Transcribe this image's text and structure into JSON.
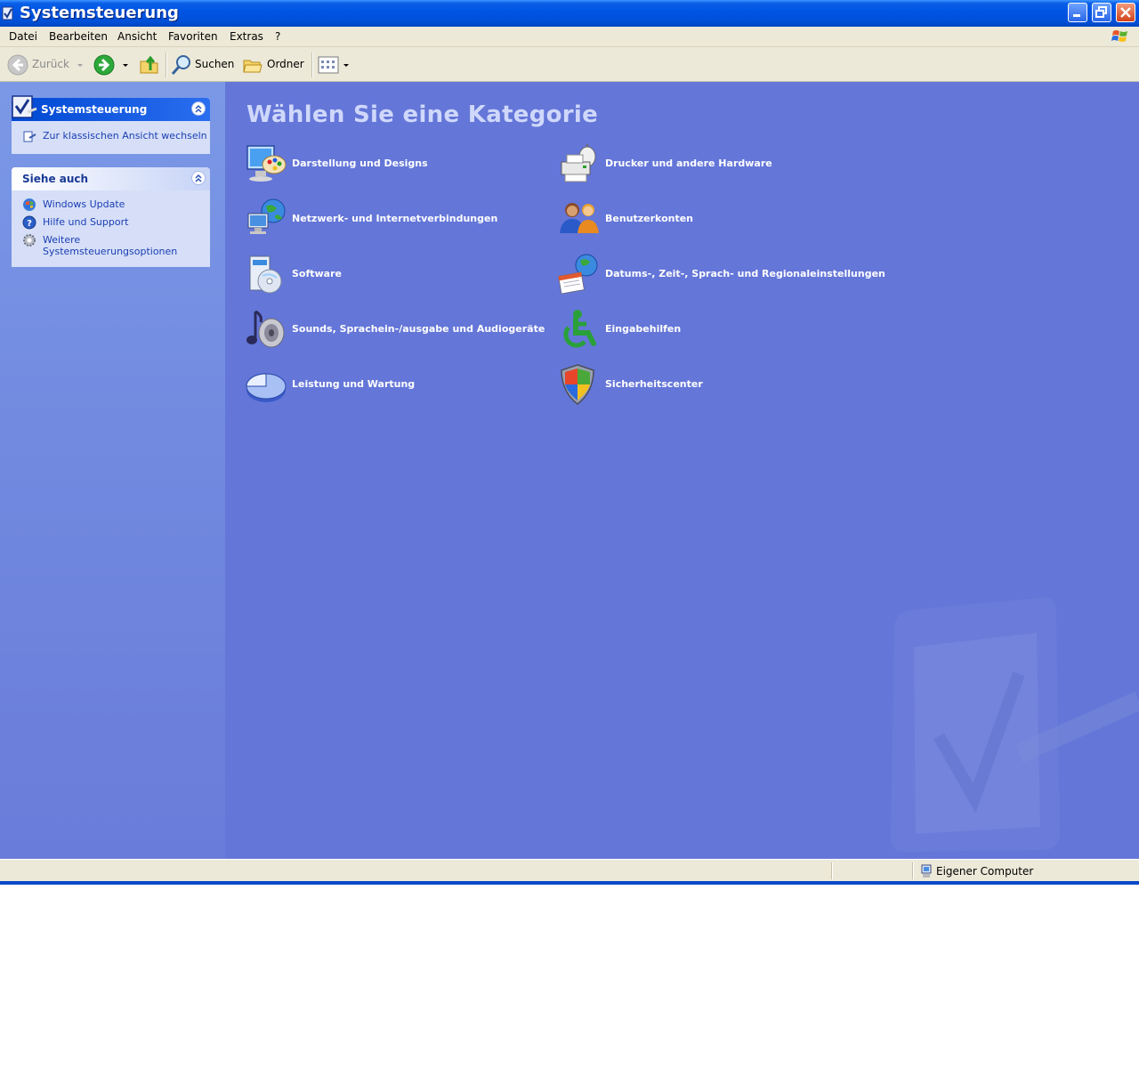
{
  "window": {
    "title": "Systemsteuerung"
  },
  "menu": [
    "Datei",
    "Bearbeiten",
    "Ansicht",
    "Favoriten",
    "Extras",
    "?"
  ],
  "toolbar": {
    "back_label": "Zurück",
    "search_label": "Suchen",
    "folders_label": "Ordner"
  },
  "tasks": {
    "panel1_title": "Systemsteuerung",
    "switch_view": "Zur klassischen Ansicht wechseln",
    "panel2_title": "Siehe auch",
    "see_also": [
      "Windows Update",
      "Hilfe und Support",
      "Weitere",
      "Systemsteuerungsoptionen"
    ]
  },
  "main": {
    "heading": "Wählen Sie eine Kategorie",
    "categories": [
      {
        "label": "Darstellung und Designs",
        "icon": "appearance-icon"
      },
      {
        "label": "Drucker und andere Hardware",
        "icon": "printer-icon"
      },
      {
        "label": "Netzwerk- und Internetverbindungen",
        "icon": "network-icon"
      },
      {
        "label": "Benutzerkonten",
        "icon": "users-icon"
      },
      {
        "label": "Software",
        "icon": "software-icon"
      },
      {
        "label": "Datums-, Zeit-, Sprach- und Regionaleinstellungen",
        "icon": "date-globe-icon"
      },
      {
        "label": "Sounds, Sprachein-/ausgabe und Audiogeräte",
        "icon": "sound-icon"
      },
      {
        "label": "Eingabehilfen",
        "icon": "accessibility-icon"
      },
      {
        "label": "Leistung und Wartung",
        "icon": "performance-icon"
      },
      {
        "label": "Sicherheitscenter",
        "icon": "security-shield-icon"
      }
    ]
  },
  "status": {
    "location": "Eigener Computer"
  },
  "colors": {
    "content_bg": "#6476d8",
    "title_bar": "#0055e5",
    "heading": "#cfd8fa"
  }
}
